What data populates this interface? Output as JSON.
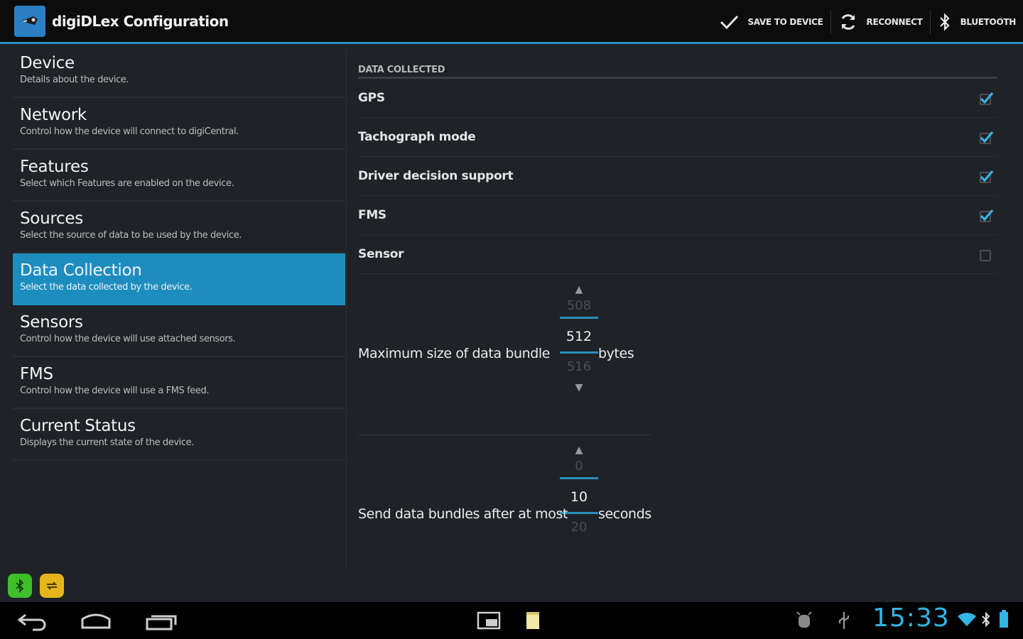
{
  "app": {
    "title": "digiDLex Configuration",
    "icon": "app-logo-icon"
  },
  "actions": {
    "save": "SAVE TO DEVICE",
    "reconnect": "RECONNECT",
    "bluetooth": "BLUETOOTH"
  },
  "nav": {
    "items": [
      {
        "title": "Device",
        "subtitle": "Details about the device."
      },
      {
        "title": "Network",
        "subtitle": "Control how the device will connect to digiCentral."
      },
      {
        "title": "Features",
        "subtitle": "Select which Features are enabled on the device."
      },
      {
        "title": "Sources",
        "subtitle": "Select the source of data to be used by the device."
      },
      {
        "title": "Data Collection",
        "subtitle": "Select the data collected by the device."
      },
      {
        "title": "Sensors",
        "subtitle": "Control how the device will use attached sensors."
      },
      {
        "title": "FMS",
        "subtitle": "Control how the device will use a FMS feed."
      },
      {
        "title": "Current Status",
        "subtitle": "Displays the current state of the device."
      }
    ],
    "selected": "Data Collection"
  },
  "data_collected": {
    "header": "DATA COLLECTED",
    "items": [
      {
        "label": "GPS",
        "checked": true
      },
      {
        "label": "Tachograph mode",
        "checked": true
      },
      {
        "label": "Driver decision support",
        "checked": true
      },
      {
        "label": "FMS",
        "checked": true
      },
      {
        "label": "Sensor",
        "checked": false
      }
    ]
  },
  "bundle_size": {
    "label": "Maximum size of data bundle",
    "prev": "508",
    "value": "512",
    "next": "516",
    "unit": "bytes"
  },
  "bundle_time": {
    "label": "Send data bundles after at most",
    "prev": "0",
    "value": "10",
    "next": "20",
    "unit": "seconds"
  },
  "status": {
    "time": "15:33"
  },
  "colors": {
    "accent": "#33b5e5",
    "selected": "#1d8dbf"
  }
}
